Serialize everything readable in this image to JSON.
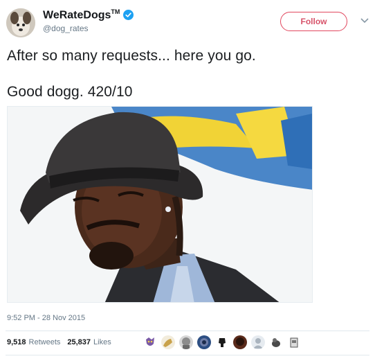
{
  "header": {
    "display_name": "WeRateDogs",
    "trademark": "TM",
    "handle": "@dog_rates",
    "follow_label": "Follow"
  },
  "tweet": {
    "line1": "After so many requests... here you go.",
    "line2": "Good dogg. 420/10"
  },
  "image": {
    "description_icon": "photo-of-man-in-hat"
  },
  "meta": {
    "timestamp": "9:52 PM - 28 Nov 2015"
  },
  "stats": {
    "retweets_count": "9,518",
    "retweets_label": "Retweets",
    "likes_count": "25,837",
    "likes_label": "Likes"
  },
  "colors": {
    "follow_accent": "#e1475e",
    "verified": "#1da1f2",
    "muted_text": "#657786"
  }
}
